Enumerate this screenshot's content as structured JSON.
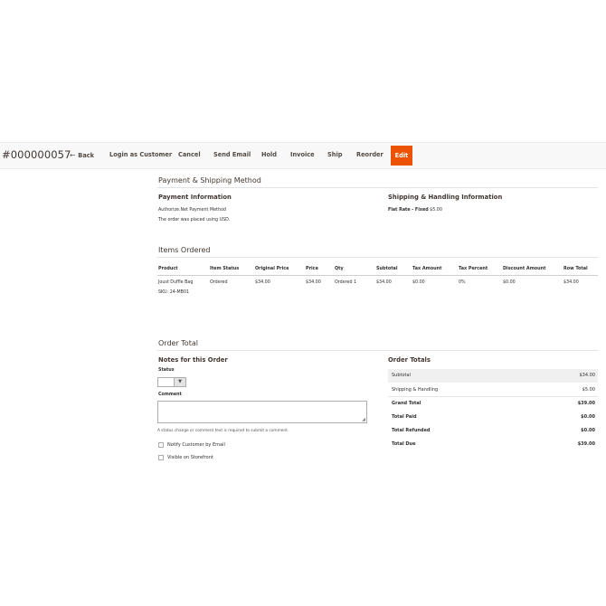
{
  "header": {
    "order_number": "#000000057",
    "actions": {
      "back": "Back",
      "login_as_customer": "Login as Customer",
      "cancel": "Cancel",
      "send_email": "Send Email",
      "hold": "Hold",
      "invoice": "Invoice",
      "ship": "Ship",
      "reorder": "Reorder",
      "edit": "Edit"
    },
    "edit_color": "#eb5202"
  },
  "payment_shipping": {
    "section_title": "Payment & Shipping Method",
    "payment_title": "Payment Information",
    "payment_method": "Authorize.Net Payment Method",
    "currency_note": "The order was placed using USD.",
    "shipping_title": "Shipping & Handling Information",
    "shipping_method": "Flat Rate - Fixed",
    "shipping_price": "$5.00"
  },
  "items": {
    "section_title": "Items Ordered",
    "columns": [
      "Product",
      "Item Status",
      "Original Price",
      "Price",
      "Qty",
      "Subtotal",
      "Tax Amount",
      "Tax Percent",
      "Discount Amount",
      "Row Total"
    ],
    "rows": [
      {
        "product": "Joust Duffle Bag",
        "sku": "SKU: 24-MB01",
        "status": "Ordered",
        "original_price": "$34.00",
        "price": "$34.00",
        "qty": "Ordered 1",
        "subtotal": "$34.00",
        "tax_amount": "$0.00",
        "tax_percent": "0%",
        "discount_amount": "$0.00",
        "row_total": "$34.00"
      }
    ]
  },
  "order_total": {
    "section_title": "Order Total",
    "notes_title": "Notes for this Order",
    "status_label": "Status",
    "status_value": "",
    "comment_label": "Comment",
    "comment_value": "",
    "comment_hint": "A status change or comment text is required to submit a comment.",
    "notify_label": "Notify Customer by Email",
    "visible_label": "Visible on Storefront",
    "totals_title": "Order Totals",
    "totals": {
      "subtotal_label": "Subtotal",
      "subtotal": "$34.00",
      "shipping_label": "Shipping & Handling",
      "shipping": "$5.00",
      "grand_total_label": "Grand Total",
      "grand_total": "$39.00",
      "total_paid_label": "Total Paid",
      "total_paid": "$0.00",
      "total_refunded_label": "Total Refunded",
      "total_refunded": "$0.00",
      "total_due_label": "Total Due",
      "total_due": "$39.00"
    }
  }
}
